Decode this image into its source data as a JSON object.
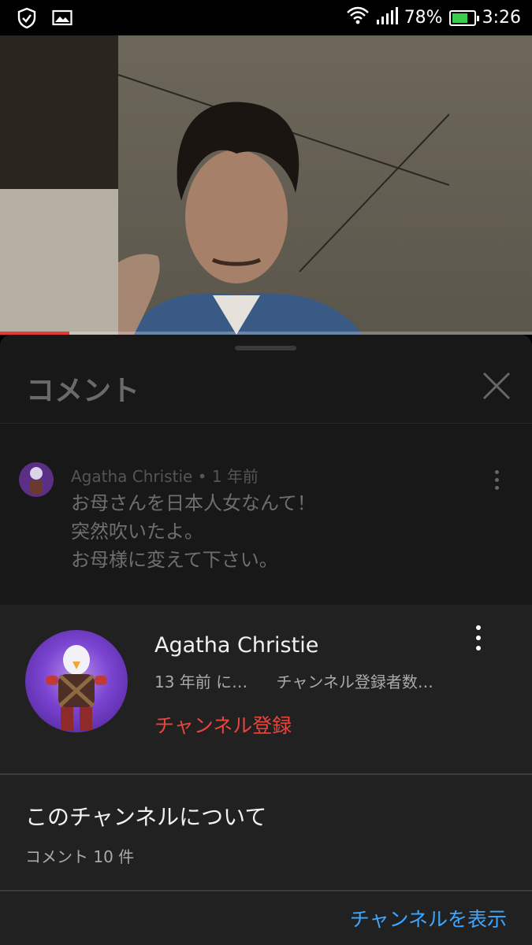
{
  "status_bar": {
    "battery_percent": "78%",
    "time": "3:26",
    "battery_level": 0.78,
    "icons": [
      "shield-check-icon",
      "image-icon",
      "wifi-icon",
      "signal-icon",
      "battery-charging-icon"
    ]
  },
  "video": {
    "progress": 0.13,
    "accent_color": "#e53935"
  },
  "comments_sheet": {
    "title": "コメント",
    "comment": {
      "author": "Agatha Christie",
      "separator": "•",
      "age": "1 年前",
      "lines": [
        "お母さんを日本人女なんて！",
        "突然吹いたよ。",
        "お母様に変えて下さい。"
      ]
    }
  },
  "channel_popup": {
    "name": "Agatha Christie",
    "joined": "13 年前 に…",
    "subscribers": "チャンネル登録者数…",
    "subscribe_label": "チャンネル登録",
    "about_title": "このチャンネルについて",
    "comment_count": "コメント 10 件",
    "view_channel_label": "チャンネルを表示",
    "colors": {
      "subscribe": "#e8453c",
      "link": "#3ea6ff"
    }
  }
}
